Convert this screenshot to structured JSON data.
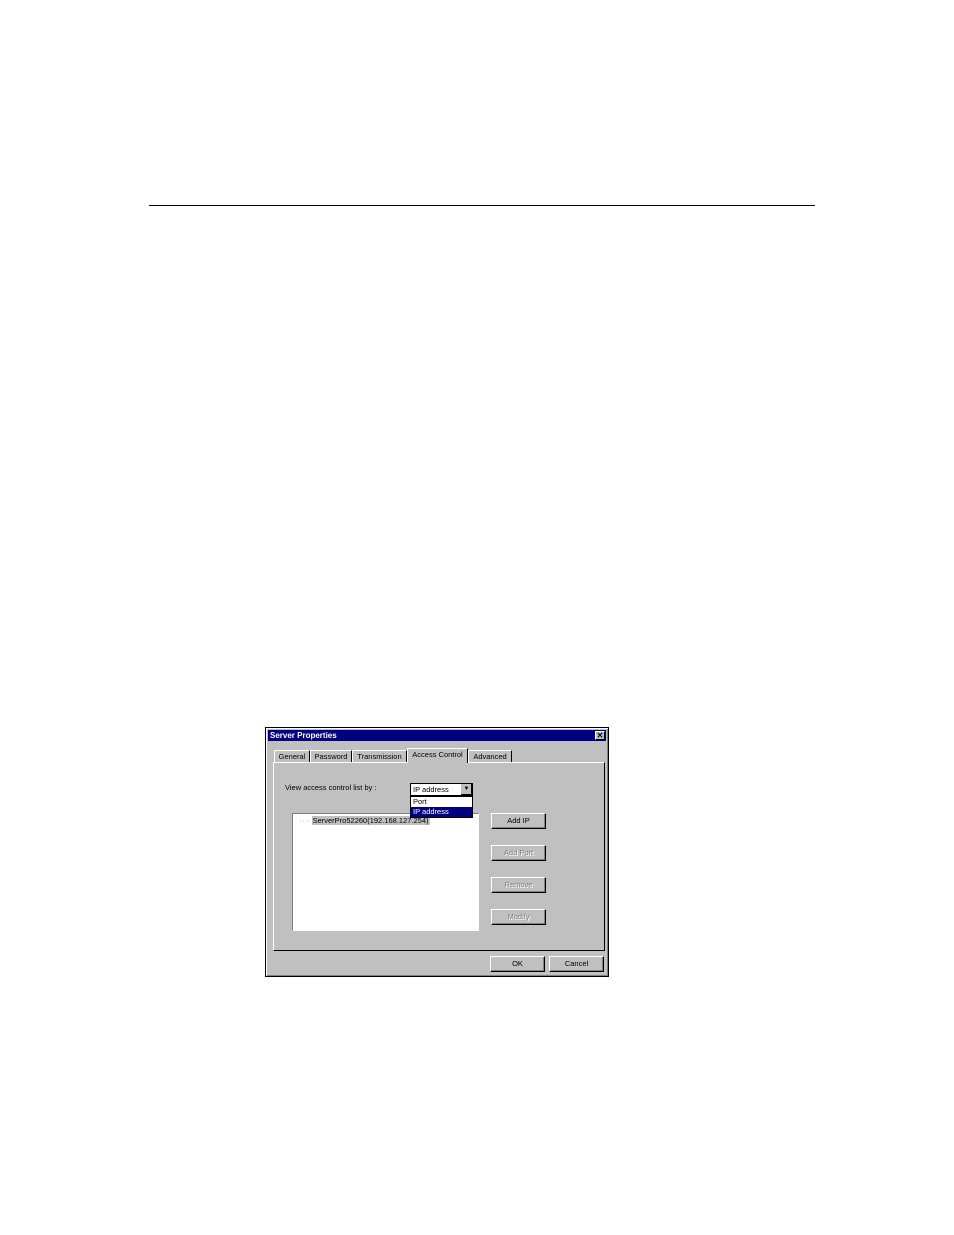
{
  "window": {
    "title": "Server Properties",
    "close_glyph": "✕"
  },
  "tabs": [
    {
      "label": "General"
    },
    {
      "label": "Password"
    },
    {
      "label": "Transmission"
    },
    {
      "label": "Access Control",
      "active": true
    },
    {
      "label": "Advanced"
    }
  ],
  "view_by": {
    "label": "View access control list by :",
    "selected": "IP address",
    "arrow": "▼",
    "options": [
      "Port",
      "IP address"
    ],
    "highlighted": "IP address"
  },
  "list": {
    "items": [
      "ServerPro52260(192.168.127.254)"
    ],
    "connector": "···"
  },
  "buttons": {
    "add_ip": "Add IP",
    "add_port": "Add Port",
    "remove": "Remove",
    "modify": "Modify",
    "ok": "OK",
    "cancel": "Cancel"
  }
}
